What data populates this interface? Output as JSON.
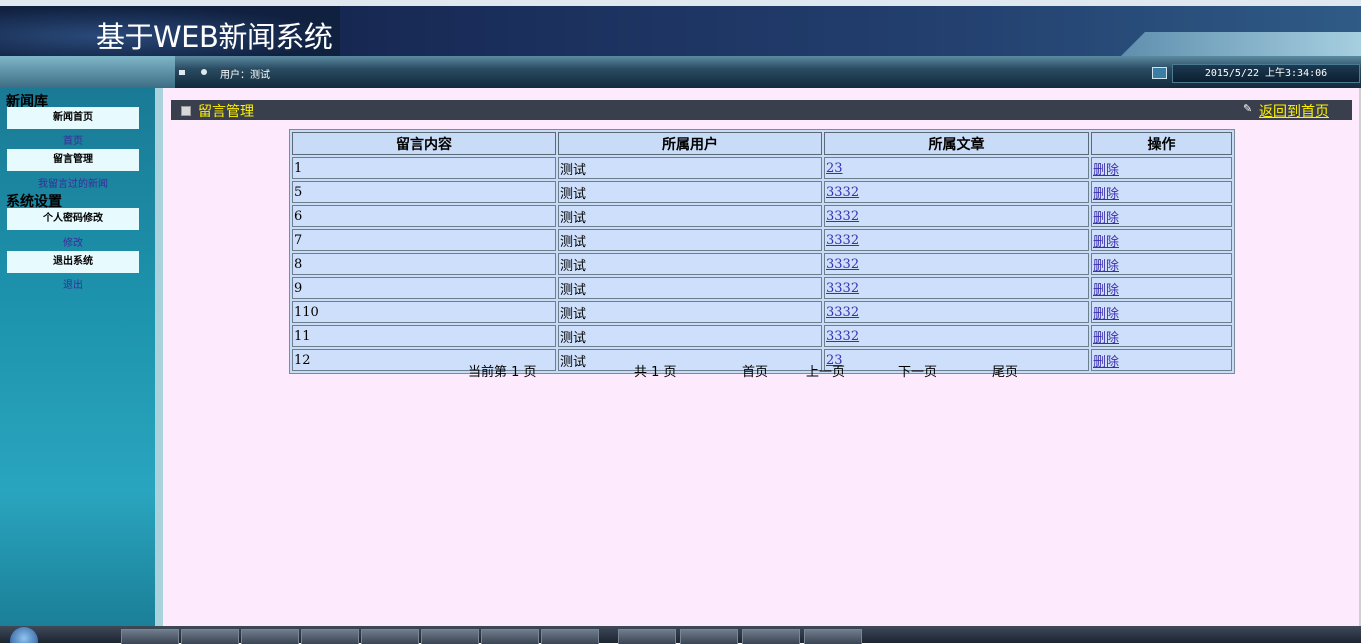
{
  "app": {
    "title": "基于WEB新闻系统",
    "user_label": "用户：测试",
    "datetime": "2015/5/22 上午3:34:06"
  },
  "sidebar": {
    "sections": [
      {
        "heading": "新闻库",
        "items": [
          {
            "label": "新闻首页",
            "sub": "首页"
          },
          {
            "label": "留言管理",
            "sub": "我留言过的新闻"
          }
        ]
      },
      {
        "heading": "系统设置",
        "items": [
          {
            "label": "个人密码修改",
            "sub": "修改"
          },
          {
            "label": "退出系统",
            "sub": "退出"
          }
        ]
      }
    ]
  },
  "panel": {
    "title": "留言管理",
    "back_link": "返回到首页"
  },
  "table": {
    "headers": [
      "留言内容",
      "所属用户",
      "所属文章",
      "操作"
    ],
    "rows": [
      {
        "content": "1",
        "user": "测试",
        "article": "23",
        "action": "删除"
      },
      {
        "content": "5",
        "user": "测试",
        "article": "3332",
        "action": "删除"
      },
      {
        "content": "6",
        "user": "测试",
        "article": "3332",
        "action": "删除"
      },
      {
        "content": "7",
        "user": "测试",
        "article": "3332",
        "action": "删除"
      },
      {
        "content": "8",
        "user": "测试",
        "article": "3332",
        "action": "删除"
      },
      {
        "content": "9",
        "user": "测试",
        "article": "3332",
        "action": "删除"
      },
      {
        "content": "110",
        "user": "测试",
        "article": "3332",
        "action": "删除"
      },
      {
        "content": "11",
        "user": "测试",
        "article": "3332",
        "action": "删除"
      },
      {
        "content": "12",
        "user": "测试",
        "article": "23",
        "action": "删除"
      }
    ]
  },
  "pager": {
    "current": "当前第 1 页",
    "total": "共 1 页",
    "first": "首页",
    "prev": "上一页",
    "next": "下一页",
    "last": "尾页"
  },
  "colors": {
    "banner": "#1a2d5a",
    "sidebar": "#1d93ad",
    "main_bg": "#fdebfd",
    "panel_bar": "#3a3f4d",
    "panel_title": "#fff200",
    "table_cell": "#cddffa"
  }
}
